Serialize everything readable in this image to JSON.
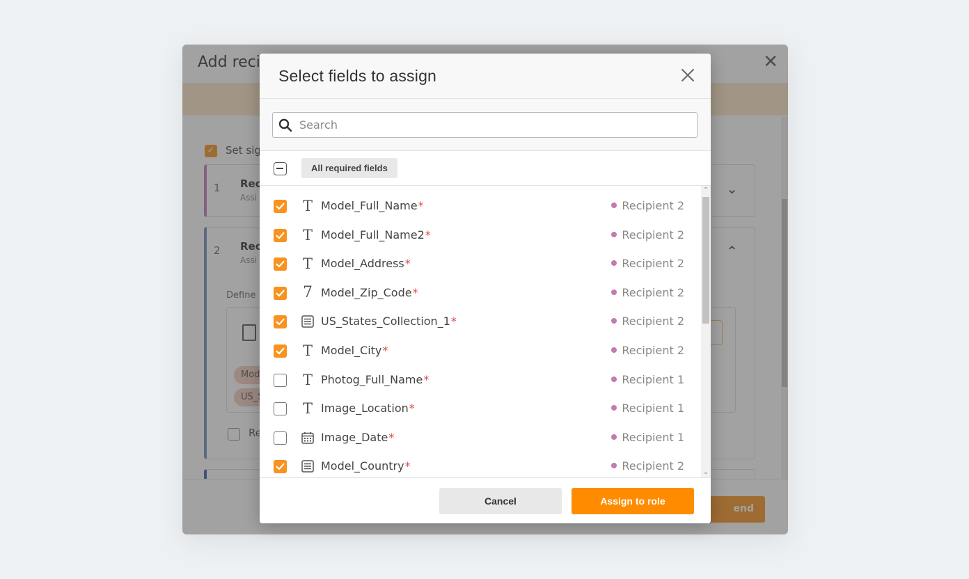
{
  "background_dialog": {
    "title": "Add reci",
    "close_glyph": "✕",
    "set_signing_label": "Set sig",
    "recipients": [
      {
        "num": "1",
        "name": "Rec",
        "sub": "Assi",
        "color": "#c27bb3"
      },
      {
        "num": "2",
        "name": "Rec",
        "sub": "Assi",
        "color": "#6e8fb8"
      }
    ],
    "define_label": "Define",
    "chips": [
      "Mod",
      "US_S"
    ],
    "checkbox_label": "Re",
    "send_label": "end"
  },
  "modal": {
    "title": "Select fields to assign",
    "search": {
      "placeholder": "Search",
      "value": ""
    },
    "filter_chip": "All required fields",
    "cancel_label": "Cancel",
    "assign_label": "Assign to role",
    "accent_color": "#f7931e",
    "fields": [
      {
        "name": "Model_Full_Name",
        "icon": "text-icon",
        "checked": true,
        "required_mark": "*",
        "recipient": "Recipient 2"
      },
      {
        "name": "Model_Full_Name2",
        "icon": "text-icon",
        "checked": true,
        "required_mark": "*",
        "recipient": "Recipient 2"
      },
      {
        "name": "Model_Address",
        "icon": "text-icon",
        "checked": true,
        "required_mark": "*",
        "recipient": "Recipient 2"
      },
      {
        "name": "Model_Zip_Code",
        "icon": "number-icon",
        "checked": true,
        "required_mark": "*",
        "recipient": "Recipient 2"
      },
      {
        "name": "US_States_Collection_1",
        "icon": "dropdown-icon",
        "checked": true,
        "required_mark": "*",
        "recipient": "Recipient 2"
      },
      {
        "name": "Model_City",
        "icon": "text-icon",
        "checked": true,
        "required_mark": "*",
        "recipient": "Recipient 2"
      },
      {
        "name": "Photog_Full_Name",
        "icon": "text-icon",
        "checked": false,
        "required_mark": "*",
        "recipient": "Recipient 1"
      },
      {
        "name": "Image_Location",
        "icon": "text-icon",
        "checked": false,
        "required_mark": "*",
        "recipient": "Recipient 1"
      },
      {
        "name": "Image_Date",
        "icon": "calendar-icon",
        "checked": false,
        "required_mark": "*",
        "recipient": "Recipient 1"
      },
      {
        "name": "Model_Country",
        "icon": "dropdown-icon",
        "checked": true,
        "required_mark": "*",
        "recipient": "Recipient 2"
      }
    ]
  }
}
